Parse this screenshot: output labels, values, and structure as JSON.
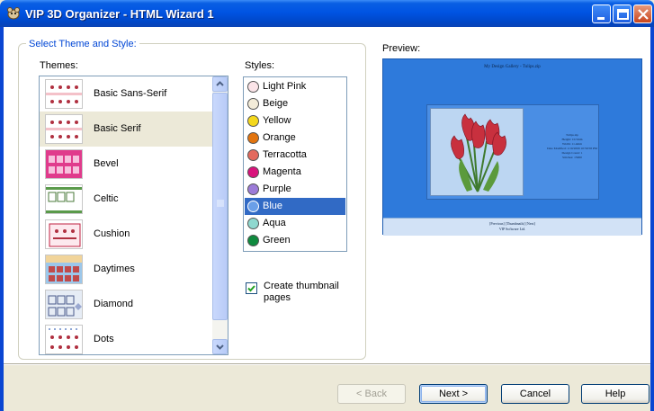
{
  "window": {
    "title": "VIP 3D Organizer - HTML Wizard 1"
  },
  "group": {
    "legend": "Select Theme and Style:"
  },
  "themes": {
    "label": "Themes:",
    "selected": "Basic Serif",
    "items": [
      {
        "label": "Basic Sans-Serif",
        "icon": "theme-thumb-basic-sans-serif"
      },
      {
        "label": "Basic Serif",
        "icon": "theme-thumb-basic-serif"
      },
      {
        "label": "Bevel",
        "icon": "theme-thumb-bevel"
      },
      {
        "label": "Celtic",
        "icon": "theme-thumb-celtic"
      },
      {
        "label": "Cushion",
        "icon": "theme-thumb-cushion"
      },
      {
        "label": "Daytimes",
        "icon": "theme-thumb-daytimes"
      },
      {
        "label": "Diamond",
        "icon": "theme-thumb-diamond"
      },
      {
        "label": "Dots",
        "icon": "theme-thumb-dots"
      }
    ]
  },
  "styles": {
    "label": "Styles:",
    "selected": "Blue",
    "items": [
      {
        "label": "Light Pink",
        "color": "#fbe4e8"
      },
      {
        "label": "Beige",
        "color": "#f3ecd9"
      },
      {
        "label": "Yellow",
        "color": "#f4d81c"
      },
      {
        "label": "Orange",
        "color": "#e2740f"
      },
      {
        "label": "Terracotta",
        "color": "#e36a5e"
      },
      {
        "label": "Magenta",
        "color": "#d9137c"
      },
      {
        "label": "Purple",
        "color": "#9c7bd8"
      },
      {
        "label": "Blue",
        "color": "#6a9fe8"
      },
      {
        "label": "Aqua",
        "color": "#8fd8cf"
      },
      {
        "label": "Green",
        "color": "#0f8a3e"
      }
    ]
  },
  "thumbnail_option": {
    "label": "Create thumbnail pages",
    "checked": true
  },
  "preview": {
    "label": "Preview:",
    "page_title": "My Design Gallery - Tulips.zip",
    "info_lines": [
      "Tulips.zip",
      "Height: 10.5mm",
      "Width: 11.4mm",
      "Date Modified: 1/10/2009 10:59:58 PM",
      "Design Count: 1",
      "Stitches: 15000"
    ],
    "footer_lines": [
      "[Previous] [Thumbnails] [Next]",
      "VIP Software Ltd."
    ]
  },
  "buttons": {
    "back": "< Back",
    "next": "Next >",
    "cancel": "Cancel",
    "help": "Help"
  },
  "colors": {
    "titlebar": "#0054e3",
    "selection": "#316ac5",
    "preview_bg": "#2e7adb"
  }
}
